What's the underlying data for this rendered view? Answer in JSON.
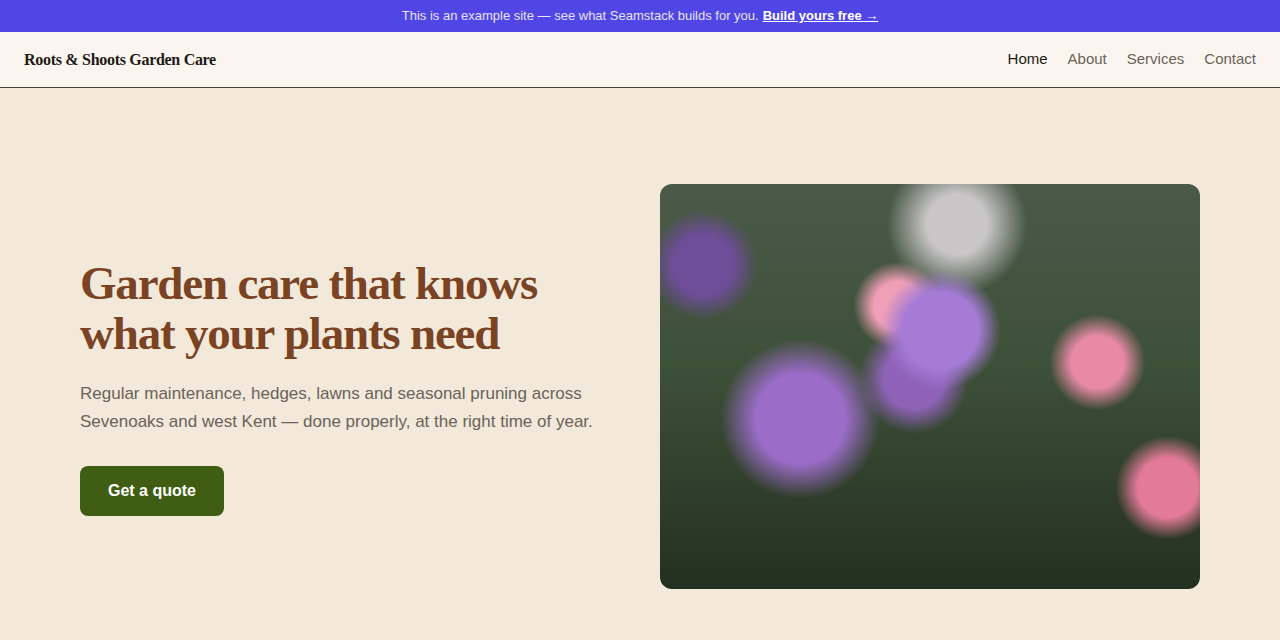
{
  "banner": {
    "text": "This is an example site — see what Seamstack builds for you.",
    "link": "Build yours free →"
  },
  "brand": "Roots & Shoots Garden Care",
  "nav": [
    {
      "label": "Home",
      "selected": true
    },
    {
      "label": "About",
      "selected": false
    },
    {
      "label": "Services",
      "selected": false
    },
    {
      "label": "Contact",
      "selected": false
    }
  ],
  "hero": {
    "title": "Garden care that knows what your plants need",
    "text": "Regular maintenance, hedges, lawns and seasonal pruning across Sevenoaks and west Kent — done properly, at the right time of year.",
    "button": "Get a quote"
  }
}
